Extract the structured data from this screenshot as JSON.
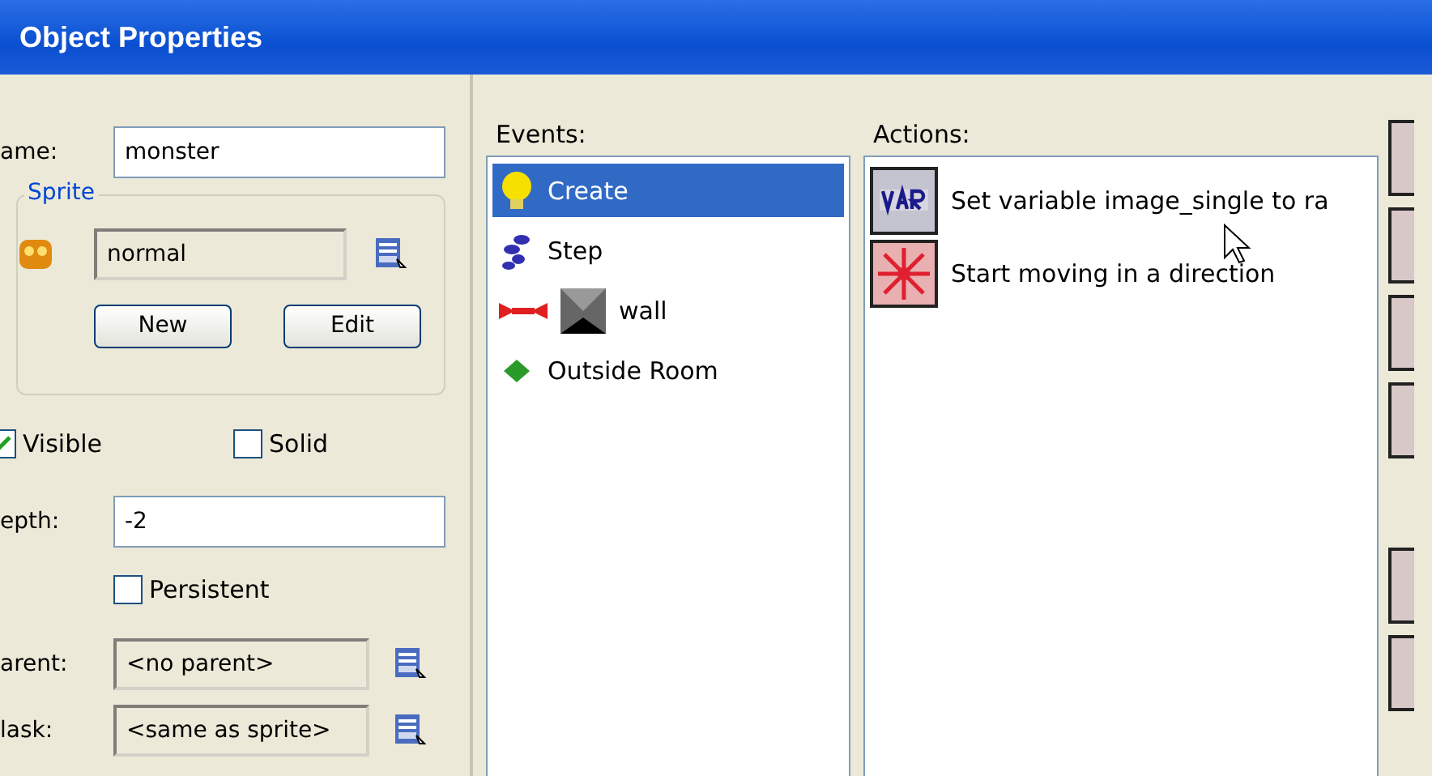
{
  "window": {
    "title": "Object Properties"
  },
  "name_field": {
    "label": "ame:",
    "value": "monster"
  },
  "sprite": {
    "group_label": "Sprite",
    "value": "normal",
    "buttons": [
      "New",
      "Edit"
    ]
  },
  "flags": [
    {
      "label": "Visible",
      "checked": true
    },
    {
      "label": "Solid",
      "checked": false
    }
  ],
  "depth_field": {
    "label": "epth:",
    "value": "-2"
  },
  "persistent": {
    "label": "Persistent",
    "checked": false
  },
  "parent_field": {
    "label": "arent:",
    "value": "<no parent>"
  },
  "mask_field": {
    "label": "lask:",
    "value": "<same as sprite>"
  },
  "events": {
    "label": "Events:",
    "items": [
      {
        "kind": "create",
        "label": "Create",
        "selected": true
      },
      {
        "kind": "step",
        "label": "Step",
        "selected": false
      },
      {
        "kind": "collision",
        "label": "wall",
        "selected": false
      },
      {
        "kind": "other",
        "label": "Outside Room",
        "selected": false
      }
    ]
  },
  "actions": {
    "label": "Actions:",
    "items": [
      {
        "kind": "variable",
        "label": "Set variable image_single to ra"
      },
      {
        "kind": "move",
        "label": "Start moving in a direction"
      }
    ]
  }
}
